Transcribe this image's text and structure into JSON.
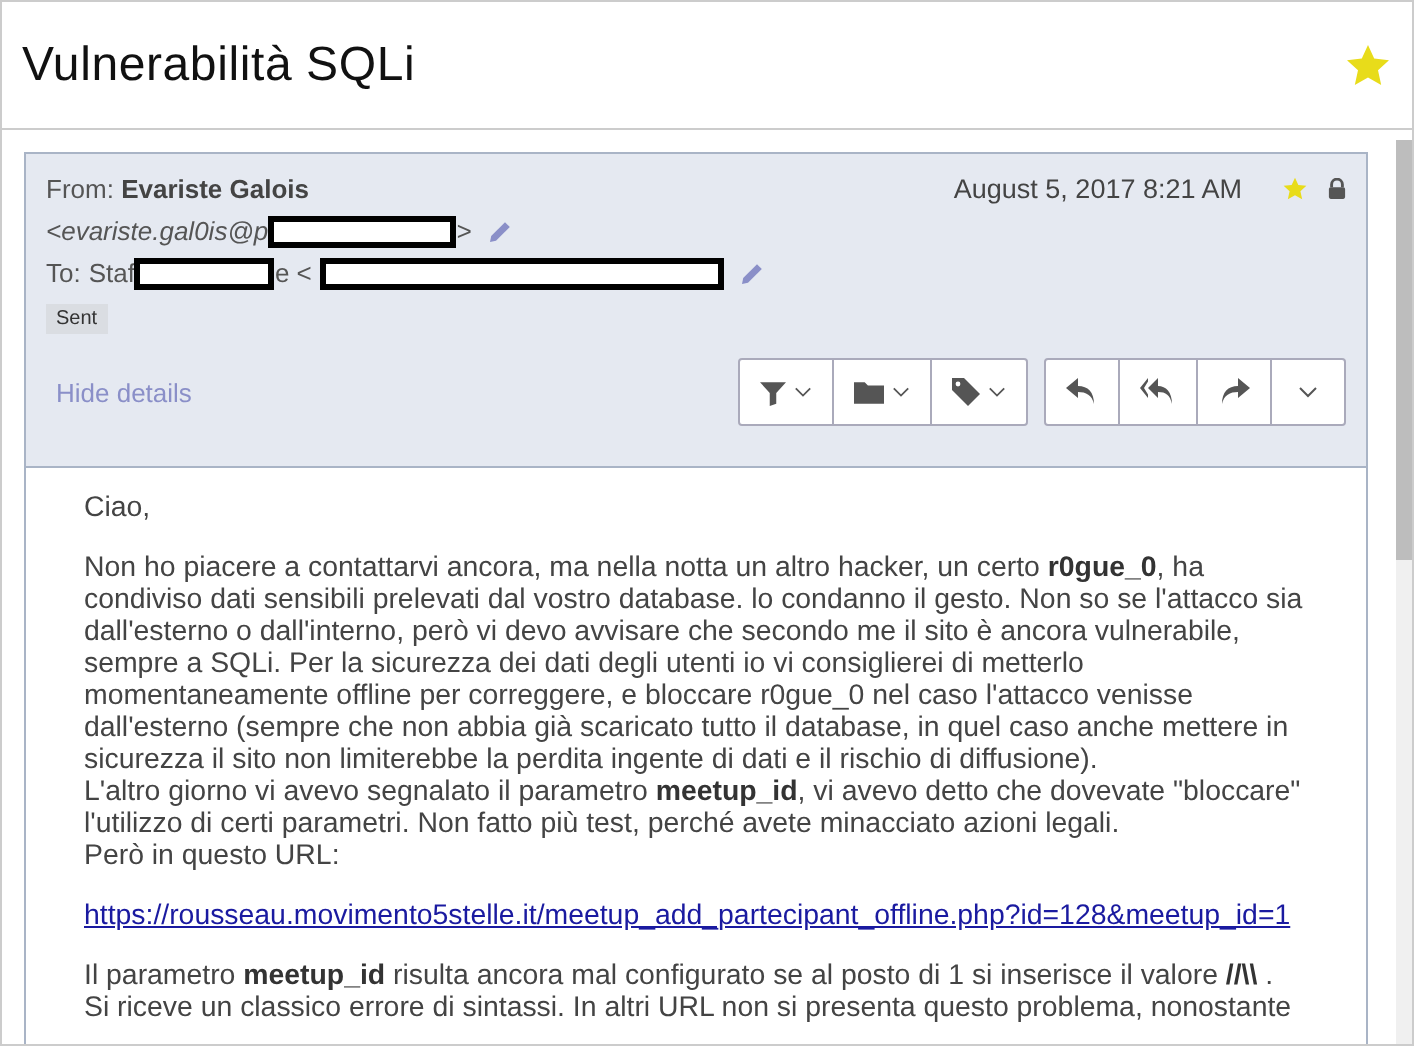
{
  "page": {
    "title": "Vulnerabilità SQLi",
    "starred": true
  },
  "message": {
    "from_label": "From:",
    "from_name": "Evariste Galois",
    "date": "August 5, 2017 8:21 AM",
    "starred": true,
    "locked": true,
    "from_address_start": "<evariste.gal0is@p",
    "from_address_end": ">",
    "to_label": "To:",
    "to_start": "Staf",
    "to_middle": "e <",
    "tag": "Sent",
    "hide_details": "Hide details",
    "body": [
      {
        "kind": "para",
        "text": "Ciao,"
      },
      {
        "kind": "para",
        "text": "Non ho piacere a contattarvi ancora, ma nella notta un altro hacker, un certo **r0gue_0**, ha condiviso dati sensibili prelevati dal vostro database. lo condanno il gesto. Non so se l'attacco sia dall'esterno o dall'interno, però vi devo avvisare che secondo me il sito è ancora vulnerabile, sempre a SQLi. Per la sicurezza dei dati degli utenti io vi consiglierei di metterlo momentaneamente offline per correggere, e bloccare r0gue_0 nel caso l'attacco venisse dall'esterno (sempre che non abbia già scaricato tutto il database, in quel caso anche mettere in sicurezza il sito non limiterebbe la perdita ingente di dati e il rischio di diffusione).\nL'altro giorno vi avevo segnalato il parametro **meetup_id**, vi avevo detto che dovevate \"bloccare\" l'utilizzo di certi parametri. Non fatto più test, perché avete minacciato azioni legali.\nPerò in questo URL:"
      },
      {
        "kind": "link",
        "text": "https://rousseau.movimento5stelle.it/meetup_add_partecipant_offline.php?id=128&meetup_id=1"
      },
      {
        "kind": "para",
        "text": "Il parametro **meetup_id** risulta ancora mal configurato se al posto di 1 si inserisce il valore **//\\\\** .\nSi riceve un classico errore di sintassi. In altri URL non si presenta questo problema, nonostante"
      }
    ]
  }
}
